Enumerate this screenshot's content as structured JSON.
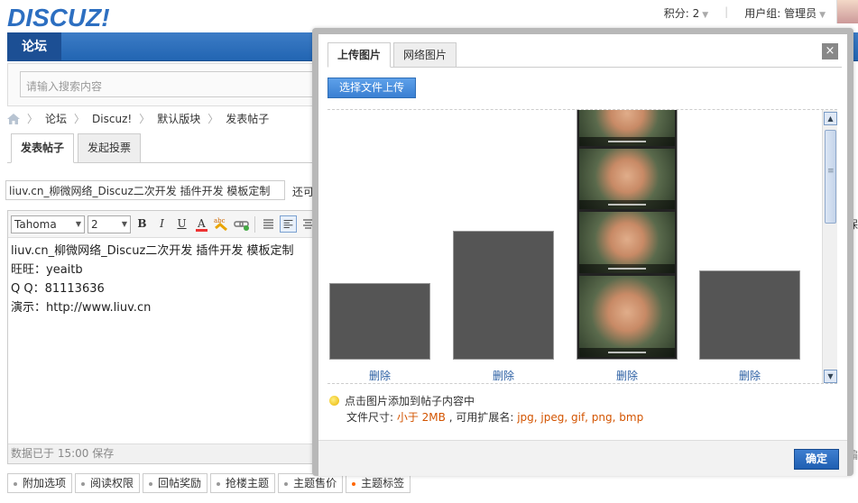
{
  "header": {
    "logo_text": "DISCUZ!",
    "points_label": "积分: 2",
    "usergroup_label": "用户组: 管理员"
  },
  "nav": {
    "forum_tab": "论坛",
    "search_placeholder": "请输入搜索内容"
  },
  "breadcrumb": [
    "论坛",
    "Discuz!",
    "默认版块",
    "发表帖子"
  ],
  "post_tabs": [
    "发表帖子",
    "发起投票"
  ],
  "subject": {
    "value": "liuv.cn_柳微网络_Discuz二次开发 插件开发 模板定制",
    "tip": "还可输"
  },
  "editor": {
    "font": "Tahoma",
    "size": "2",
    "content_lines": [
      "liuv.cn_柳微网络_Discuz二次开发 插件开发 模板定制",
      "旺旺：yeaitb",
      "Q  Q：81113636",
      "演示：http://www.liuv.cn"
    ],
    "status": "数据已于 15:00 保存"
  },
  "options": [
    "附加选项",
    "阅读权限",
    "回帖奖励",
    "抢楼主题",
    "主题售价",
    "主题标签"
  ],
  "right_edge": {
    "top": "保",
    "bottom": "编"
  },
  "dialog": {
    "tabs": [
      "上传图片",
      "网络图片"
    ],
    "close_label": "×",
    "upload_button": "选择文件上传",
    "delete_label": "删除",
    "tip_line1": "点击图片添加到帖子内容中",
    "tip_size_prefix": "文件尺寸: ",
    "tip_size_value": "小于 2MB",
    "tip_ext_prefix": " , 可用扩展名: ",
    "tip_ext_value": "jpg, jpeg, gif, png, bmp",
    "ok_button": "确定"
  },
  "colors": {
    "nav_blue": "#2a6cb8",
    "link_blue": "#2b5fa3",
    "highlight_orange": "#d35400"
  }
}
